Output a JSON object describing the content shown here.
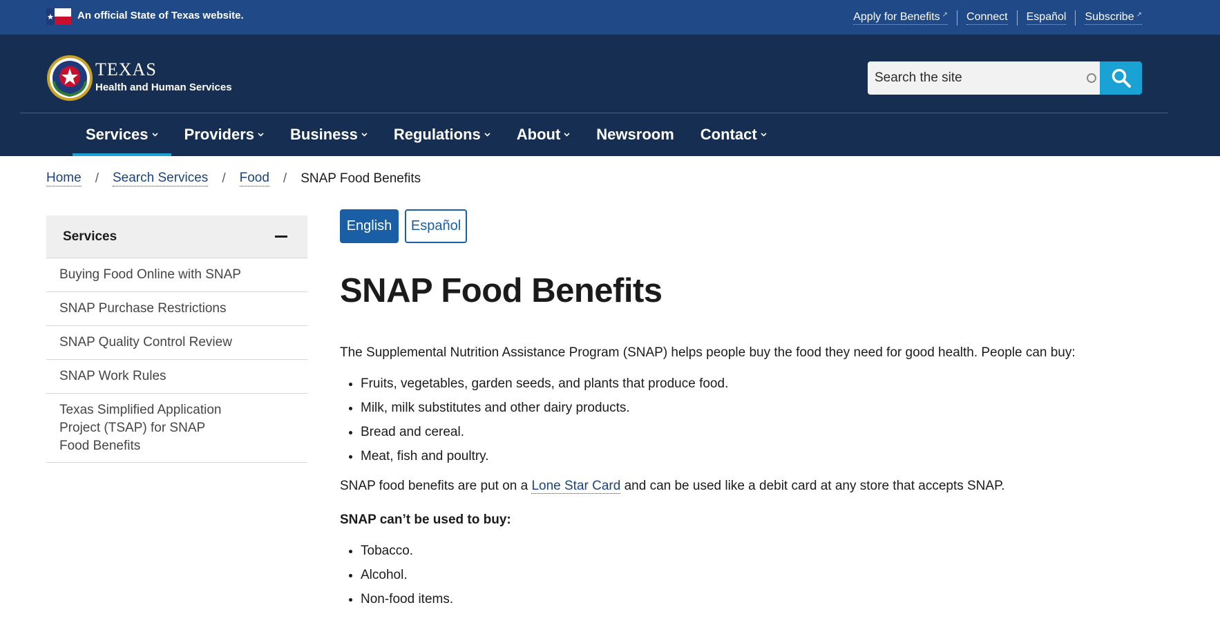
{
  "banner": {
    "official_text": "An official State of Texas website.",
    "links": [
      {
        "label": "Apply for Benefits",
        "external": true
      },
      {
        "label": "Connect",
        "external": false
      },
      {
        "label": "Español",
        "external": false
      },
      {
        "label": "Subscribe",
        "external": true
      }
    ]
  },
  "header": {
    "logo_title": "TEXAS",
    "logo_subtitle": "Health and Human Services",
    "search_placeholder": "Search the site"
  },
  "nav": {
    "items": [
      {
        "label": "Services",
        "dropdown": true,
        "active": true
      },
      {
        "label": "Providers",
        "dropdown": true,
        "active": false
      },
      {
        "label": "Business",
        "dropdown": true,
        "active": false
      },
      {
        "label": "Regulations",
        "dropdown": true,
        "active": false
      },
      {
        "label": "About",
        "dropdown": true,
        "active": false
      },
      {
        "label": "Newsroom",
        "dropdown": false,
        "active": false
      },
      {
        "label": "Contact",
        "dropdown": true,
        "active": false
      }
    ]
  },
  "breadcrumb": {
    "items": [
      "Home",
      "Search Services",
      "Food"
    ],
    "current": "SNAP Food Benefits",
    "separator": "/"
  },
  "sidebar": {
    "title": "Services",
    "items": [
      "Buying Food Online with SNAP",
      "SNAP Purchase Restrictions",
      "SNAP Quality Control Review",
      "SNAP Work Rules",
      "Texas Simplified Application Project (TSAP) for SNAP Food Benefits"
    ]
  },
  "language": {
    "english": "English",
    "spanish": "Español"
  },
  "page": {
    "title": "SNAP Food Benefits",
    "intro": "The Supplemental Nutrition Assistance Program (SNAP) helps people buy the food they need for good health. People can buy:",
    "can_buy": [
      "Fruits, vegetables, garden seeds, and plants that produce food.",
      "Milk, milk substitutes and other dairy products.",
      "Bread and cereal.",
      "Meat, fish and poultry."
    ],
    "card_text_before": "SNAP food benefits are put on a ",
    "card_link": "Lone Star Card",
    "card_text_after": " and can be used like a debit card at any store that accepts SNAP.",
    "cant_buy_heading": "SNAP can’t be used to buy:",
    "cant_buy": [
      "Tobacco.",
      "Alcohol.",
      "Non-food items."
    ]
  },
  "colors": {
    "banner_bg": "#1f4a87",
    "header_bg": "#162e51",
    "accent": "#1aa2d4",
    "link": "#1a4480",
    "button": "#1a5fa6"
  }
}
